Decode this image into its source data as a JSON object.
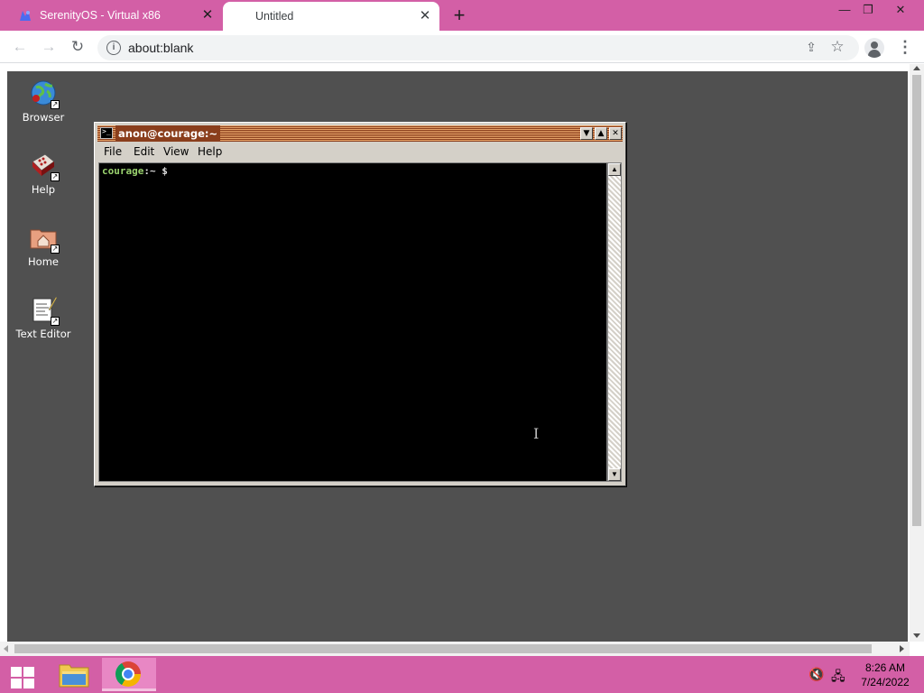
{
  "browser": {
    "tabs": [
      {
        "title": "SerenityOS - Virtual x86",
        "active": false
      },
      {
        "title": "Untitled",
        "active": true
      }
    ],
    "address": "about:blank",
    "theme_color": "#d35fa6"
  },
  "desktop": {
    "background": "#505050",
    "icons": [
      {
        "label": "Browser"
      },
      {
        "label": "Help"
      },
      {
        "label": "Home"
      },
      {
        "label": "Text Editor"
      }
    ]
  },
  "terminal": {
    "title": "anon@courage:~",
    "menu": [
      "File",
      "Edit",
      "View",
      "Help"
    ],
    "prompt_host": "courage",
    "prompt_rest": ":~ $",
    "title_color": "#a3542a"
  },
  "taskbar": {
    "time": "8:26 AM",
    "date": "7/24/2022"
  }
}
